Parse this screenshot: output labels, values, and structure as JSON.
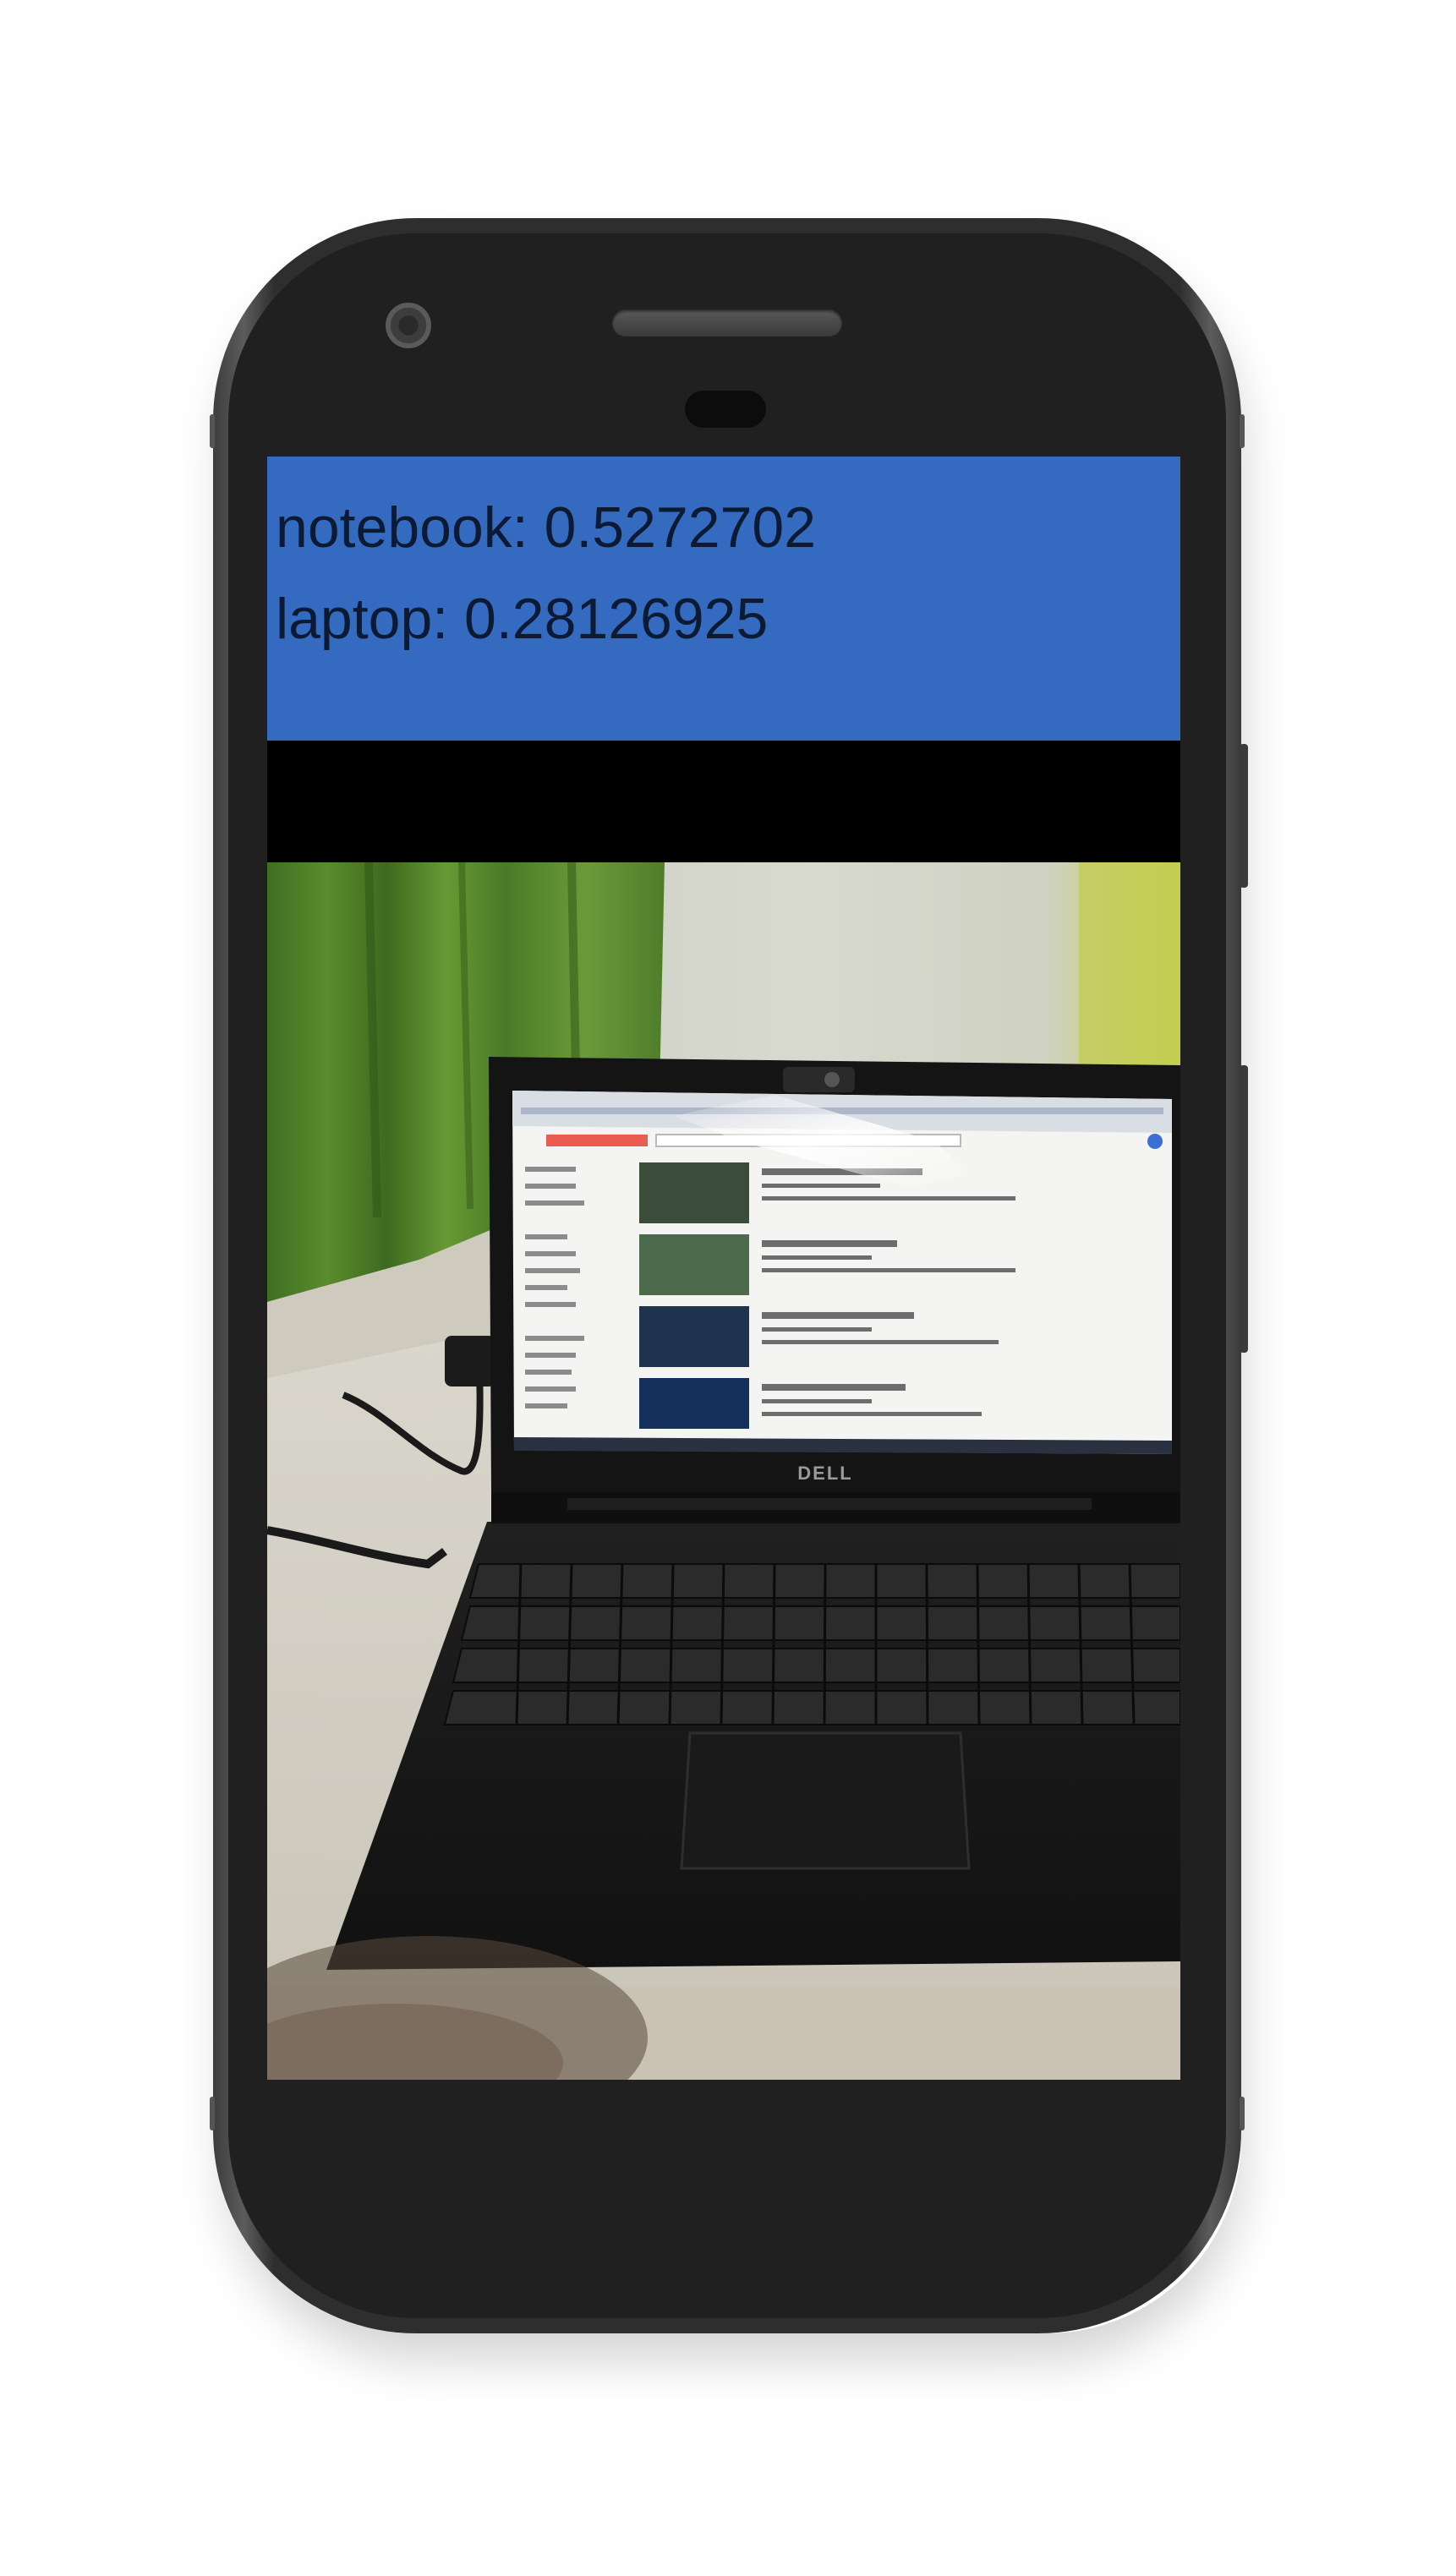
{
  "app": {
    "results": [
      {
        "label": "notebook",
        "confidence": "0.5272702"
      },
      {
        "label": "laptop",
        "confidence": "0.28126925"
      }
    ],
    "result_lines": [
      "notebook: 0.5272702",
      "laptop: 0.28126925"
    ]
  },
  "camera_preview": {
    "subject": "laptop",
    "laptop_brand": "DELL"
  },
  "colors": {
    "results_background": "#346bc1",
    "results_text": "#0d1a33",
    "screen_background": "#212121",
    "divider_bar": "#000000",
    "phone_frame": "#2e2e2e"
  },
  "icons": {
    "front_camera": "front-camera-icon",
    "speaker": "speaker-grille-icon",
    "sensor": "proximity-sensor-icon"
  }
}
